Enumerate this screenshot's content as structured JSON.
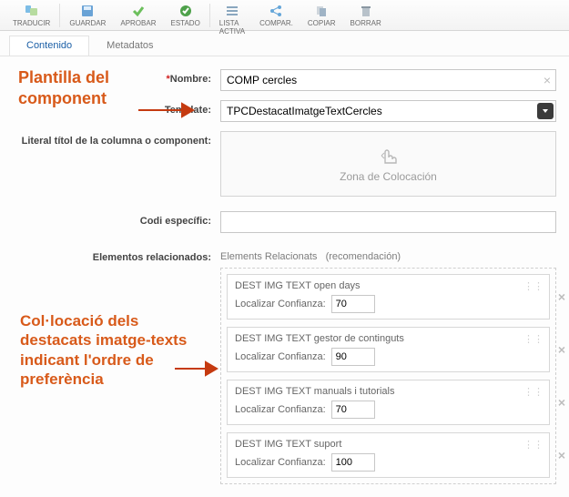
{
  "toolbar": {
    "traducir": "TRADUCIR",
    "guardar": "GUARDAR",
    "aprobar": "APROBAR",
    "estado": "ESTADO",
    "lista_activa": "LISTA\nACTIVA",
    "compa": "COMPAR.",
    "copiar": "COPIAR",
    "borrar": "BORRAR"
  },
  "tabs": {
    "contenido": "Contenido",
    "metadatos": "Metadatos"
  },
  "labels": {
    "nombre": "Nombre:",
    "template": "Template:",
    "literal": "Literal títol de la columna o component:",
    "codi": "Codi específic:",
    "elementos": "Elementos relacionados:",
    "dropzone": "Zona de Colocación",
    "rel_header_left": "Elements Relacionats",
    "rel_header_right": "(recomendación)",
    "loc_conf": "Localizar Confianza:"
  },
  "values": {
    "nombre": "COMP cercles",
    "template": "TPCDestacatImatgeTextCercles",
    "codi": ""
  },
  "related": [
    {
      "title": "DEST IMG TEXT open days",
      "conf": "70"
    },
    {
      "title": "DEST IMG TEXT gestor de continguts",
      "conf": "90"
    },
    {
      "title": "DEST IMG TEXT manuals i tutorials",
      "conf": "70"
    },
    {
      "title": "DEST IMG TEXT suport",
      "conf": "100"
    }
  ],
  "annotations": {
    "a1": "Plantilla del component",
    "a2": "Col·locació dels destacats imatge-texts indicant l'ordre de preferència"
  }
}
